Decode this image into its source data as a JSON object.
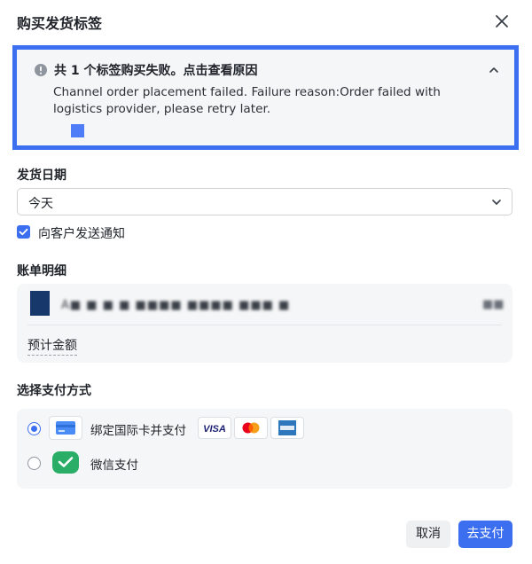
{
  "dialog": {
    "title": "购买发货标签"
  },
  "alert": {
    "title": "共 1 个标签购买失败。点击查看原因",
    "message": "Channel order placement failed. Failure reason:Order failed with logistics provider, please retry later."
  },
  "ship_date": {
    "label": "发货日期",
    "value": "今天"
  },
  "notify": {
    "label": "向客户发送通知",
    "checked": true
  },
  "bill": {
    "label": "账单明细",
    "item_text": "A■ ■ ■ ■ ■■■■ ■■■■ ■■■ ■",
    "item_price": "■■",
    "total_label": "预计金额",
    "total_value": ""
  },
  "payment": {
    "label": "选择支付方式",
    "options": [
      {
        "label": "绑定国际卡并支付",
        "icon": "credit-card-icon",
        "selected": true
      },
      {
        "label": "微信支付",
        "icon": "wechat-pay-icon",
        "selected": false
      }
    ],
    "card_brands": [
      "VISA",
      "mastercard",
      "amex"
    ]
  },
  "buttons": {
    "cancel": "取消",
    "pay": "去支付"
  },
  "colors": {
    "primary": "#3c6ef0",
    "alert_border": "#3c6ef0",
    "panel_bg": "#f5f6f7"
  }
}
